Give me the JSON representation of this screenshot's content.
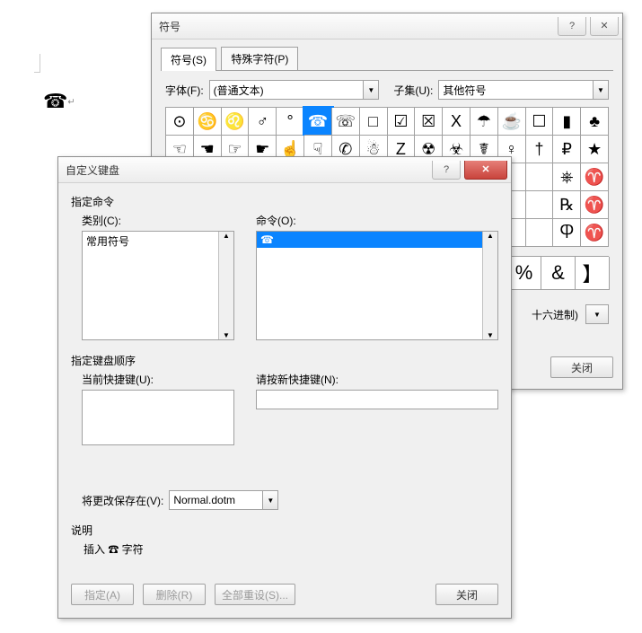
{
  "symbol_dialog": {
    "title": "符号",
    "tab_symbols": "符号(S)",
    "tab_special": "特殊字符(P)",
    "font_label": "字体(F):",
    "font_value": "(普通文本)",
    "subset_label": "子集(U):",
    "subset_value": "其他符号",
    "grid": [
      [
        "⊙",
        "♋",
        "♌",
        "♂",
        "°",
        "☎",
        "☏",
        "□",
        "☑",
        "☒",
        "X",
        "☂",
        "☕",
        "☐",
        "▮",
        "♣"
      ],
      [
        "☜",
        "☚",
        "☞",
        "☛",
        "☝",
        "☟",
        "✆",
        "☃",
        "Z",
        "☢",
        "☣",
        "☤",
        "♀",
        "†",
        "₽",
        "★"
      ],
      [
        "",
        "",
        "",
        "",
        "",
        "",
        "",
        "",
        "",
        "",
        "",
        "",
        "",
        "",
        "⎈",
        "♈"
      ],
      [
        "",
        "",
        "",
        "",
        "",
        "",
        "",
        "",
        "",
        "",
        "",
        "",
        "",
        "",
        "℞",
        "♈"
      ],
      [
        "",
        "",
        "",
        "",
        "",
        "",
        "",
        "",
        "",
        "",
        "",
        "",
        "",
        "",
        "Ⴔ",
        "♈"
      ]
    ],
    "grid_selected": [
      0,
      5
    ],
    "recent_cells": [
      "%",
      "&",
      "】"
    ],
    "from_label": "十六进制)",
    "close": "关闭"
  },
  "keyboard_dialog": {
    "title": "自定义键盘",
    "cmd_group": "指定命令",
    "category_label": "类别(C):",
    "category_item": "常用符号",
    "command_label": "命令(O):",
    "command_item": "☎",
    "seq_group": "指定键盘顺序",
    "current_label": "当前快捷键(U):",
    "press_label": "请按新快捷键(N):",
    "save_label": "将更改保存在(V):",
    "save_value": "Normal.dotm",
    "desc_group": "说明",
    "desc_text": "插入 ☎ 字符",
    "btn_assign": "指定(A)",
    "btn_delete": "删除(R)",
    "btn_reset": "全部重设(S)...",
    "btn_close": "关闭"
  },
  "doc_symbol": "☎"
}
